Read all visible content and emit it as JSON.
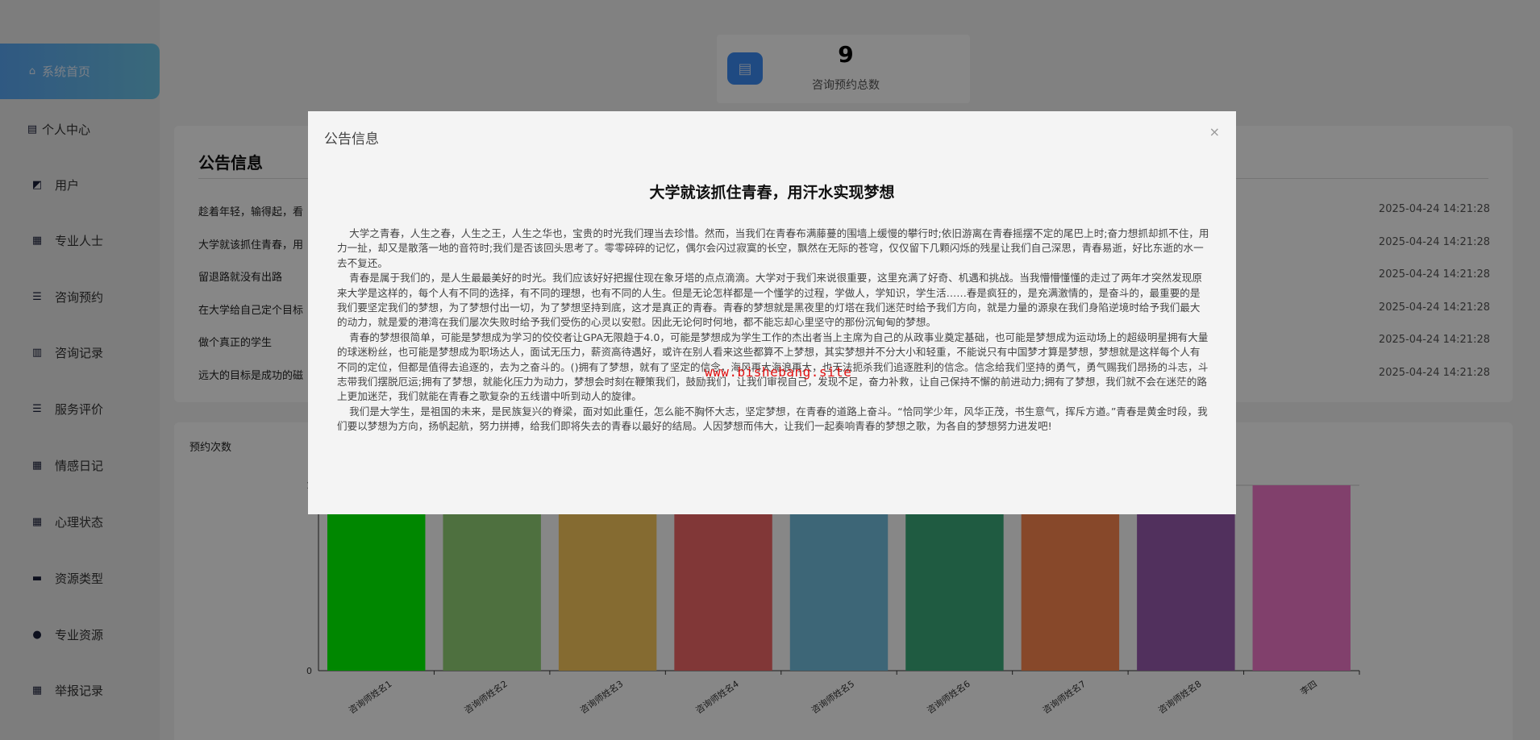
{
  "sidebar": {
    "items": [
      {
        "label": "系统首页",
        "icon": "home-icon"
      },
      {
        "label": "个人中心",
        "icon": "profile-icon"
      },
      {
        "label": "用户",
        "icon": "chart-line-icon"
      },
      {
        "label": "专业人士",
        "icon": "grid-icon"
      },
      {
        "label": "咨询预约",
        "icon": "list-icon"
      },
      {
        "label": "咨询记录",
        "icon": "bar-chart-icon"
      },
      {
        "label": "服务评价",
        "icon": "list-icon"
      },
      {
        "label": "情感日记",
        "icon": "grid-icon"
      },
      {
        "label": "心理状态",
        "icon": "grid-icon"
      },
      {
        "label": "资源类型",
        "icon": "briefcase-icon"
      },
      {
        "label": "专业资源",
        "icon": "bulb-icon"
      },
      {
        "label": "举报记录",
        "icon": "grid-icon"
      }
    ]
  },
  "stat": {
    "value": "9",
    "label": "咨询预约总数"
  },
  "notice": {
    "title": "公告信息",
    "items": [
      {
        "title": "趁着年轻，输得起，看",
        "date": "2025-04-24 14:21:28"
      },
      {
        "title": "大学就该抓住青春，用",
        "date": "2025-04-24 14:21:28"
      },
      {
        "title": "留退路就没有出路",
        "date": "2025-04-24 14:21:28"
      },
      {
        "title": "在大学给自己定个目标",
        "date": "2025-04-24 14:21:28"
      },
      {
        "title": "做个真正的学生",
        "date": "2025-04-24 14:21:28"
      },
      {
        "title": "远大的目标是成功的磁",
        "date": "2025-04-24 14:21:28"
      }
    ]
  },
  "chart_data": {
    "type": "bar",
    "title": "预约次数",
    "categories": [
      "咨询师姓名1",
      "咨询师姓名2",
      "咨询师姓名3",
      "咨询师姓名4",
      "咨询师姓名5",
      "咨询师姓名6",
      "咨询师姓名7",
      "咨询师姓名8",
      "李四"
    ],
    "values": [
      1,
      1,
      1,
      1,
      1,
      1,
      1,
      1,
      1
    ],
    "ylim": [
      0,
      1
    ],
    "yticks": [
      "0",
      "1"
    ],
    "colors": [
      "#00ff00",
      "#94d478",
      "#fcca5e",
      "#f46868",
      "#74c0e0",
      "#3cac7c",
      "#ff8850",
      "#9a5cb0",
      "#f47acc"
    ]
  },
  "modal": {
    "title": "公告信息",
    "close": "×",
    "heading": "大学就该抓住青春，用汗水实现梦想",
    "paragraphs": [
      "大学之青春，人生之春，人生之王，人生之华也，宝贵的时光我们理当去珍惜。然而，当我们在青春布满藤蔓的围墙上缓慢的攀行时;依旧游离在青春摇摆不定的尾巴上时;奋力想抓却抓不住，用力一扯，却又是散落一地的音符时;我们是否该回头思考了。零零碎碎的记忆，偶尔会闪过寂寞的长空，飘然在无际的苍穹，仅仅留下几颗闪烁的残星让我们自己深思，青春易逝，好比东逝的水一去不复还。",
      "青春是属于我们的，是人生最最美好的时光。我们应该好好把握住现在象牙塔的点点滴滴。大学对于我们来说很重要，这里充满了好奇、机遇和挑战。当我懵懵懂懂的走过了两年才突然发现原来大学是这样的，每个人有不同的选择，有不同的理想，也有不同的人生。但是无论怎样都是一个懂学的过程，学做人，学知识，学生活……春是疯狂的，是充满激情的，是奋斗的，最重要的是我们要坚定我们的梦想，为了梦想付出一切，为了梦想坚持到底，这才是真正的青春。青春的梦想就是黑夜里的灯塔在我们迷茫时给予我们方向，就是力量的源泉在我们身陷逆境时给予我们最大的动力，就是爱的港湾在我们屡次失败时给予我们受伤的心灵以安慰。因此无论何时何地，都不能忘却心里坚守的那份沉甸甸的梦想。",
      "青春的梦想很简单，可能是梦想成为学习的佼佼者让GPA无限趋于4.0，可能是梦想成为学生工作的杰出者当上主席为自己的从政事业奠定基础，也可能是梦想成为运动场上的超级明星拥有大量的球迷粉丝，也可能是梦想成为职场达人，面试无压力，薪资高待遇好，或许在别人看来这些都算不上梦想，其实梦想并不分大小和轻重，不能说只有中国梦才算是梦想，梦想就是这样每个人有不同的定位，但都是值得去追逐的，去为之奋斗的。()拥有了梦想，就有了坚定的信念，海风再大海浪再大，也无法扼杀我们追逐胜利的信念。信念给我们坚持的勇气，勇气赐我们昂扬的斗志，斗志带我们摆脱厄运;拥有了梦想，就能化压力为动力，梦想会时刻在鞭策我们，鼓励我们，让我们审视自己，发现不足，奋力补救，让自己保持不懈的前进动力;拥有了梦想，我们就不会在迷茫的路上更加迷茫，我们就能在青春之歌复杂的五线谱中听到动人的旋律。",
      "我们是大学生，是祖国的未来，是民族复兴的脊梁，面对如此重任，怎么能不胸怀大志，坚定梦想，在青春的道路上奋斗。“恰同学少年，风华正茂，书生意气，挥斥方遒。”青春是黄金时段，我们要以梦想为方向，扬帆起航，努力拼搏，给我们即将失去的青春以最好的结局。人因梦想而伟大，让我们一起奏响青春的梦想之歌，为各自的梦想努力进发吧!"
    ]
  },
  "watermark": "www.bishebang.site"
}
